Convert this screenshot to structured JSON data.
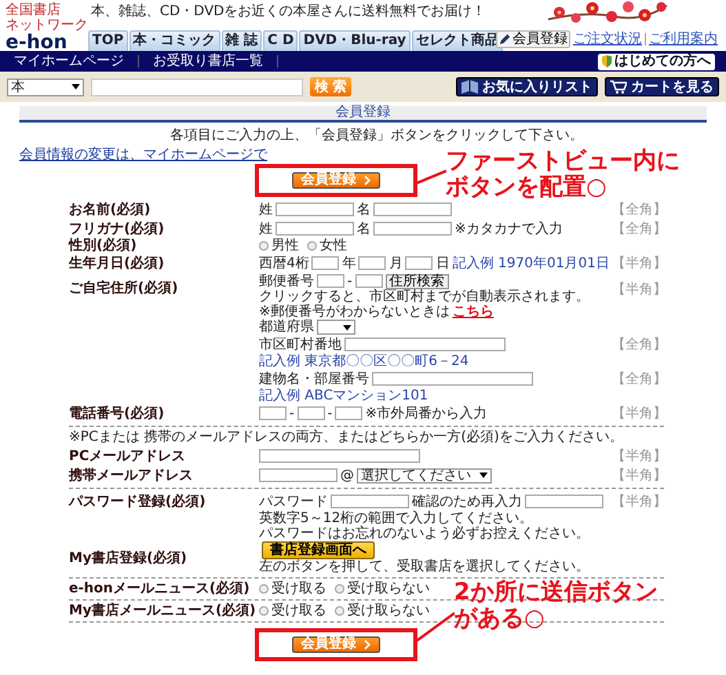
{
  "header": {
    "logo_caption": [
      "全国書店",
      "ネットワーク"
    ],
    "logo": "e-hon",
    "tagline": "本、雑誌、CD・DVDをお近くの本屋さんに送料無料でお届け！",
    "tabs": [
      "TOP",
      "本・コミック",
      "雑 誌",
      "C D",
      "DVD・Blu-ray",
      "セレクト商品"
    ],
    "register_button": "会員登録",
    "links": [
      "ご注文状況",
      "ご利用案内"
    ]
  },
  "nav": {
    "links": [
      "マイホームページ",
      "お受取り書店一覧"
    ],
    "first_time_button": "はじめての方へ"
  },
  "search": {
    "category": "本",
    "button": "検 索",
    "favorites_button": "お気に入りリスト",
    "cart_button": "カートを見る"
  },
  "form": {
    "title": "会員登録",
    "instruction": "各項目にご入力の上、「会員登録」ボタンをクリックして下さい。",
    "change_link": "会員情報の変更は、マイホームページで",
    "top_submit": {
      "label": "会員登録",
      "annotation": [
        "ファーストビュー内に",
        "ボタンを配置○"
      ]
    },
    "rows": [
      {
        "kind": "field",
        "label": "お名前(必須)",
        "lines": [
          {
            "hint": "【全角】",
            "parts": [
              {
                "kind": "text",
                "text": "姓"
              },
              {
                "kind": "input"
              },
              {
                "kind": "text",
                "text": "名"
              },
              {
                "kind": "input"
              }
            ]
          }
        ]
      },
      {
        "kind": "field",
        "label": "フリガナ(必須)",
        "lines": [
          {
            "hint": "【全角】",
            "parts": [
              {
                "kind": "text",
                "text": "姓"
              },
              {
                "kind": "input"
              },
              {
                "kind": "text",
                "text": "名"
              },
              {
                "kind": "input"
              },
              {
                "kind": "note",
                "text": "※カタカナで入力"
              }
            ]
          }
        ]
      },
      {
        "kind": "field",
        "label": "性別(必須)",
        "lines": [
          {
            "parts": [
              {
                "kind": "radio",
                "text": "男性",
                "selected": false
              },
              {
                "kind": "radio",
                "text": "女性",
                "selected": false
              }
            ]
          }
        ]
      },
      {
        "kind": "field",
        "label": "生年月日(必須)",
        "lines": [
          {
            "hint": "【半角】",
            "parts": [
              {
                "kind": "text",
                "text": "西暦4桁"
              },
              {
                "kind": "shortinput"
              },
              {
                "kind": "text",
                "text": "年"
              },
              {
                "kind": "shortinput"
              },
              {
                "kind": "text",
                "text": "月"
              },
              {
                "kind": "shortinput"
              },
              {
                "kind": "text",
                "text": "日"
              },
              {
                "kind": "example",
                "text": "記入例 1970年01月01日"
              }
            ]
          }
        ]
      },
      {
        "kind": "field",
        "label": "ご自宅住所(必須)",
        "lines": [
          {
            "hint": "【半角】",
            "parts": [
              {
                "kind": "text",
                "text": "郵便番号"
              },
              {
                "kind": "shortinput"
              },
              {
                "kind": "text",
                "text": "-"
              },
              {
                "kind": "shortinput"
              },
              {
                "kind": "button",
                "text": "住所検索"
              },
              {
                "kind": "note",
                "text": "クリックすると、市区町村までが自動表示されます。"
              }
            ]
          },
          {
            "parts": [
              {
                "kind": "note",
                "text": "※郵便番号がわからないときは"
              },
              {
                "kind": "link",
                "text": "こちら"
              }
            ]
          },
          {
            "parts": [
              {
                "kind": "text",
                "text": "都道府県"
              },
              {
                "kind": "select"
              }
            ]
          },
          {
            "hint": "【全角】",
            "parts": [
              {
                "kind": "text",
                "text": "市区町村番地"
              },
              {
                "kind": "longinput"
              }
            ]
          },
          {
            "parts": [
              {
                "kind": "example",
                "text": "記入例 東京都〇〇区〇〇町6－24"
              }
            ]
          },
          {
            "hint": "【全角】",
            "parts": [
              {
                "kind": "text",
                "text": "建物名・部屋番号"
              },
              {
                "kind": "longinput"
              }
            ]
          },
          {
            "parts": [
              {
                "kind": "example",
                "text": "記入例 ABCマンション101"
              }
            ]
          }
        ]
      },
      {
        "kind": "field",
        "label": "電話番号(必須)",
        "lines": [
          {
            "hint": "【半角】",
            "parts": [
              {
                "kind": "shortinput"
              },
              {
                "kind": "text",
                "text": "-"
              },
              {
                "kind": "shortinput"
              },
              {
                "kind": "text",
                "text": "-"
              },
              {
                "kind": "shortinput"
              },
              {
                "kind": "note",
                "text": "※市外局番から入力"
              }
            ]
          }
        ]
      },
      {
        "kind": "divider"
      },
      {
        "kind": "notice",
        "text": "※PCまたは 携帯のメールアドレスの両方、またはどちらか一方(必須)をご入力ください。"
      },
      {
        "kind": "field",
        "label": "PCメールアドレス",
        "lines": [
          {
            "hint": "【半角】",
            "parts": [
              {
                "kind": "longinput"
              }
            ]
          }
        ]
      },
      {
        "kind": "field",
        "label": "携帯メールアドレス",
        "lines": [
          {
            "hint": "【半角】",
            "parts": [
              {
                "kind": "input"
              },
              {
                "kind": "text",
                "text": "@"
              },
              {
                "kind": "select",
                "text": "選択してください"
              }
            ]
          }
        ]
      },
      {
        "kind": "divider"
      },
      {
        "kind": "field",
        "label": "パスワード登録(必須)",
        "lines": [
          {
            "hint": "【半角】",
            "parts": [
              {
                "kind": "text",
                "text": "パスワード"
              },
              {
                "kind": "input"
              },
              {
                "kind": "text",
                "text": "確認のため再入力"
              },
              {
                "kind": "input"
              }
            ]
          },
          {
            "parts": [
              {
                "kind": "note",
                "text": "英数字5～12桁の範囲で入力してください。"
              }
            ]
          },
          {
            "parts": [
              {
                "kind": "note",
                "text": "パスワードはお忘れのないよう必ずお控えください。"
              }
            ]
          }
        ]
      },
      {
        "kind": "field",
        "label": "My書店登録(必須)",
        "lines": [
          {
            "parts": [
              {
                "kind": "shopbutton",
                "text": "書店登録画面へ"
              },
              {
                "kind": "note",
                "text": "左のボタンを押して、受取書店を選択してください。"
              }
            ]
          }
        ]
      },
      {
        "kind": "divider"
      },
      {
        "kind": "field",
        "label": "e-honメールニュース(必須)",
        "lines": [
          {
            "parts": [
              {
                "kind": "radio",
                "text": "受け取る",
                "selected": false
              },
              {
                "kind": "radio",
                "text": "受け取らない",
                "selected": false
              }
            ]
          }
        ]
      },
      {
        "kind": "divider"
      },
      {
        "kind": "field",
        "label": "My書店メールニュース(必須)",
        "lines": [
          {
            "parts": [
              {
                "kind": "radio",
                "text": "受け取る",
                "selected": false
              },
              {
                "kind": "radio",
                "text": "受け取らない",
                "selected": false
              }
            ]
          }
        ]
      },
      {
        "kind": "divider"
      }
    ],
    "bottom_submit": {
      "label": "会員登録",
      "annotation": [
        "2か所に送信ボタン",
        "がある○"
      ]
    }
  }
}
